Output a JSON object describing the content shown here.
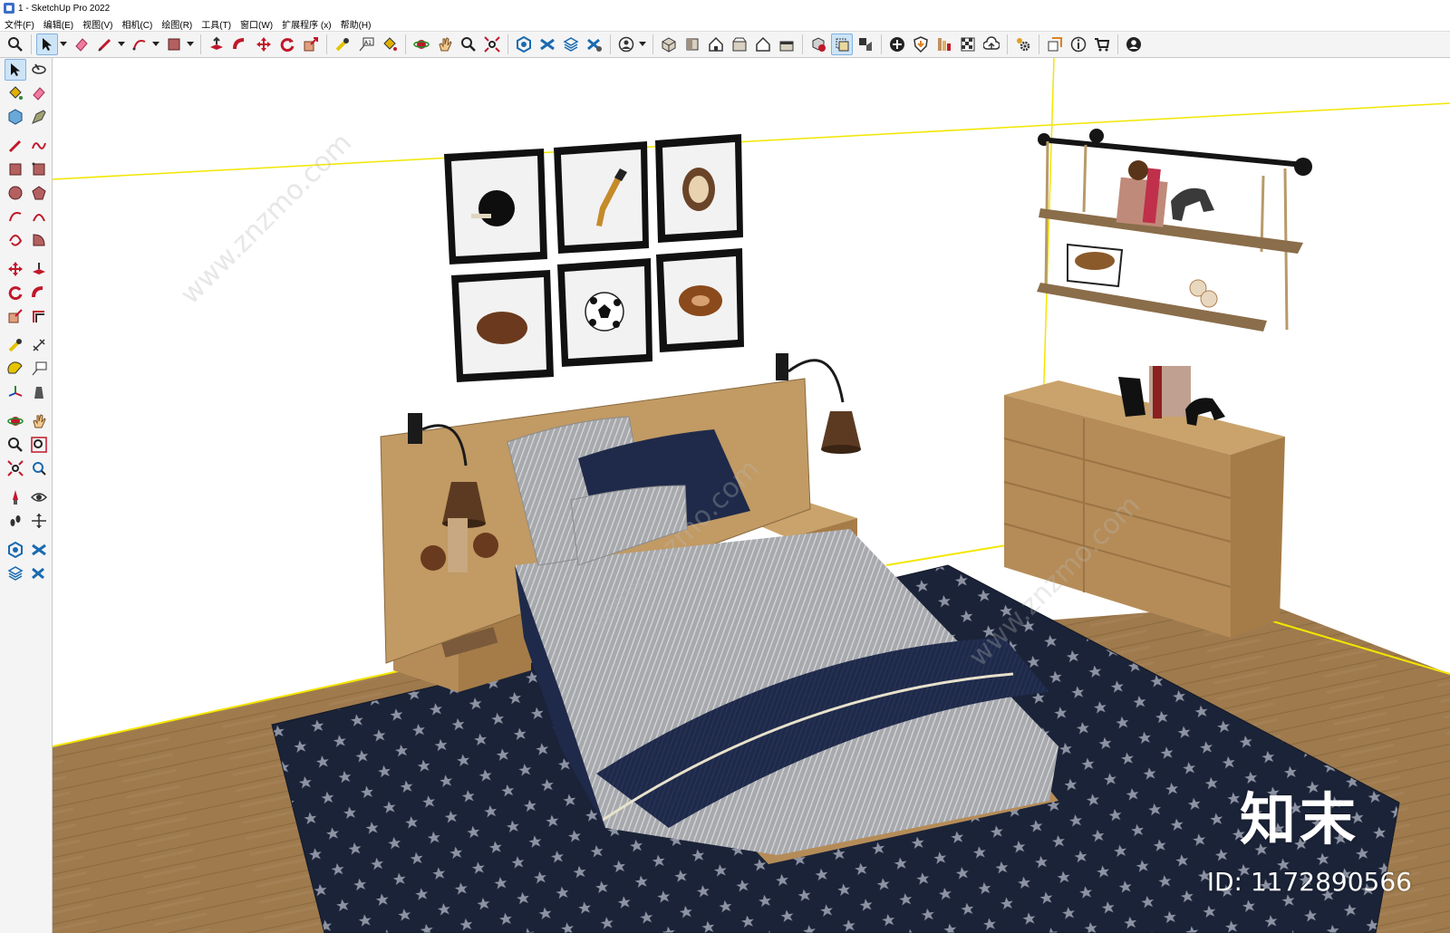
{
  "window": {
    "title": "1 - SketchUp Pro 2022"
  },
  "menu": [
    {
      "id": "file",
      "label": "文件(F)"
    },
    {
      "id": "edit",
      "label": "编辑(E)"
    },
    {
      "id": "view",
      "label": "视图(V)"
    },
    {
      "id": "camera",
      "label": "相机(C)"
    },
    {
      "id": "draw",
      "label": "绘图(R)"
    },
    {
      "id": "tools",
      "label": "工具(T)"
    },
    {
      "id": "window",
      "label": "窗口(W)"
    },
    {
      "id": "extensions",
      "label": "扩展程序 (x)"
    },
    {
      "id": "help",
      "label": "帮助(H)"
    }
  ],
  "toolbar": {
    "active_tool": "select-tool",
    "groups": [
      [
        "search-icon"
      ],
      [
        "select-arrow-icon",
        "eraser-icon",
        "pencil-line-icon",
        "arc-icon",
        "rectangle-icon"
      ],
      [
        "push-pull-icon",
        "follow-me-icon",
        "move-icon",
        "rotate-icon",
        "scale-icon"
      ],
      [
        "tape-measure-icon",
        "text-label-icon",
        "paint-bucket-icon"
      ],
      [
        "orbit-icon",
        "pan-hand-icon",
        "zoom-icon",
        "zoom-extents-icon"
      ],
      [
        "3d-warehouse-icon",
        "extension-warehouse-icon",
        "layout-send-icon",
        "extension-manager-icon"
      ],
      [
        "account-icon"
      ],
      [
        "iso-view-icon",
        "top-view-icon",
        "front-view-icon",
        "right-view-icon",
        "back-view-icon",
        "left-view-icon"
      ],
      [
        "x-ray-icon",
        "back-edges-icon",
        "hidden-line-icon"
      ],
      [
        "add-location-icon",
        "shield-icon",
        "solid-inspector-icon",
        "styles-icon",
        "cloud-icon"
      ],
      [
        "settings-icon"
      ],
      [
        "scenes-icon",
        "info-icon",
        "cart-icon"
      ],
      [
        "user-profile-icon"
      ]
    ]
  },
  "left_toolbar": {
    "rows": [
      [
        "select-arrow-icon",
        "orbit-icon"
      ],
      [
        "paint-bucket-icon",
        "eraser-icon"
      ],
      [
        "component-icon",
        "tag-icon"
      ],
      [
        "pencil-line-icon",
        "freehand-icon"
      ],
      [
        "rectangle-icon",
        "rotated-rectangle-icon"
      ],
      [
        "circle-icon",
        "polygon-icon"
      ],
      [
        "arc-icon",
        "two-point-arc-icon"
      ],
      [
        "three-point-arc-icon",
        "pie-icon"
      ],
      [
        "move-icon",
        "push-pull-icon"
      ],
      [
        "rotate-icon",
        "follow-me-icon"
      ],
      [
        "scale-icon",
        "offset-icon"
      ],
      [
        "tape-measure-icon",
        "dimension-icon"
      ],
      [
        "protractor-icon",
        "text-label-icon"
      ],
      [
        "axes-icon",
        "3d-text-icon"
      ],
      [
        "orbit-icon",
        "pan-hand-icon"
      ],
      [
        "zoom-icon",
        "zoom-window-icon"
      ],
      [
        "zoom-extents-icon",
        "previous-view-icon"
      ],
      [
        "position-camera-icon",
        "look-around-icon"
      ],
      [
        "walk-icon",
        "section-plane-icon"
      ],
      [
        "3d-warehouse-icon",
        "extension-warehouse-icon"
      ],
      [
        "layout-send-icon",
        "extension-manager-icon"
      ]
    ]
  },
  "colors": {
    "axis_yellow": "#f3e600",
    "floor_wood": "#a07c50",
    "rug_navy": "#1b2338",
    "furniture_wood": "#c49a63",
    "wall_white": "#ffffff"
  },
  "scene": {
    "watermark_text": "www.znzmo.com",
    "brand_logo": "知末",
    "brand_id": "ID: 1172890566"
  }
}
